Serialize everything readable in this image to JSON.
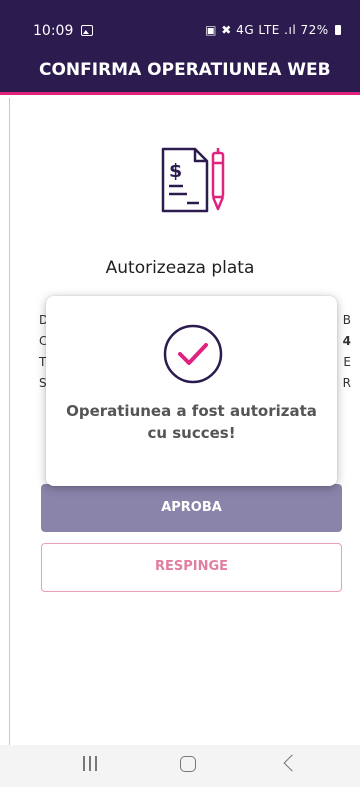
{
  "status_bar": {
    "time": "10:09",
    "indicators": "▣ ✖ 4G LTE .ıl",
    "battery": "72%",
    "icons": [
      "image-notification-icon",
      "sim-icon",
      "mute-icon",
      "signal-icon",
      "battery-icon"
    ]
  },
  "app_bar": {
    "title": "CONFIRMA OPERATIUNEA WEB"
  },
  "page": {
    "heading": "Autorizeaza plata",
    "icon": "document-sign-icon",
    "detail_rows": [
      {
        "label": "D",
        "value": "B"
      },
      {
        "label": "C",
        "value": "4"
      },
      {
        "label": "T",
        "value": "E"
      },
      {
        "label": "S",
        "value": "R"
      }
    ],
    "marker": "("
  },
  "buttons": {
    "approve": "APROBA",
    "reject": "RESPINGE"
  },
  "dialog": {
    "icon": "checkmark-circle-icon",
    "message_line1": "Operatiunea a fost autorizata",
    "message_line2": "cu succes!"
  },
  "nav_bar": {
    "icons": [
      "recents-icon",
      "home-icon",
      "back-icon"
    ]
  },
  "colors": {
    "brand_dark": "#2b1b4f",
    "accent_pink": "#e0237f",
    "approve_bg": "#8a84aa"
  }
}
